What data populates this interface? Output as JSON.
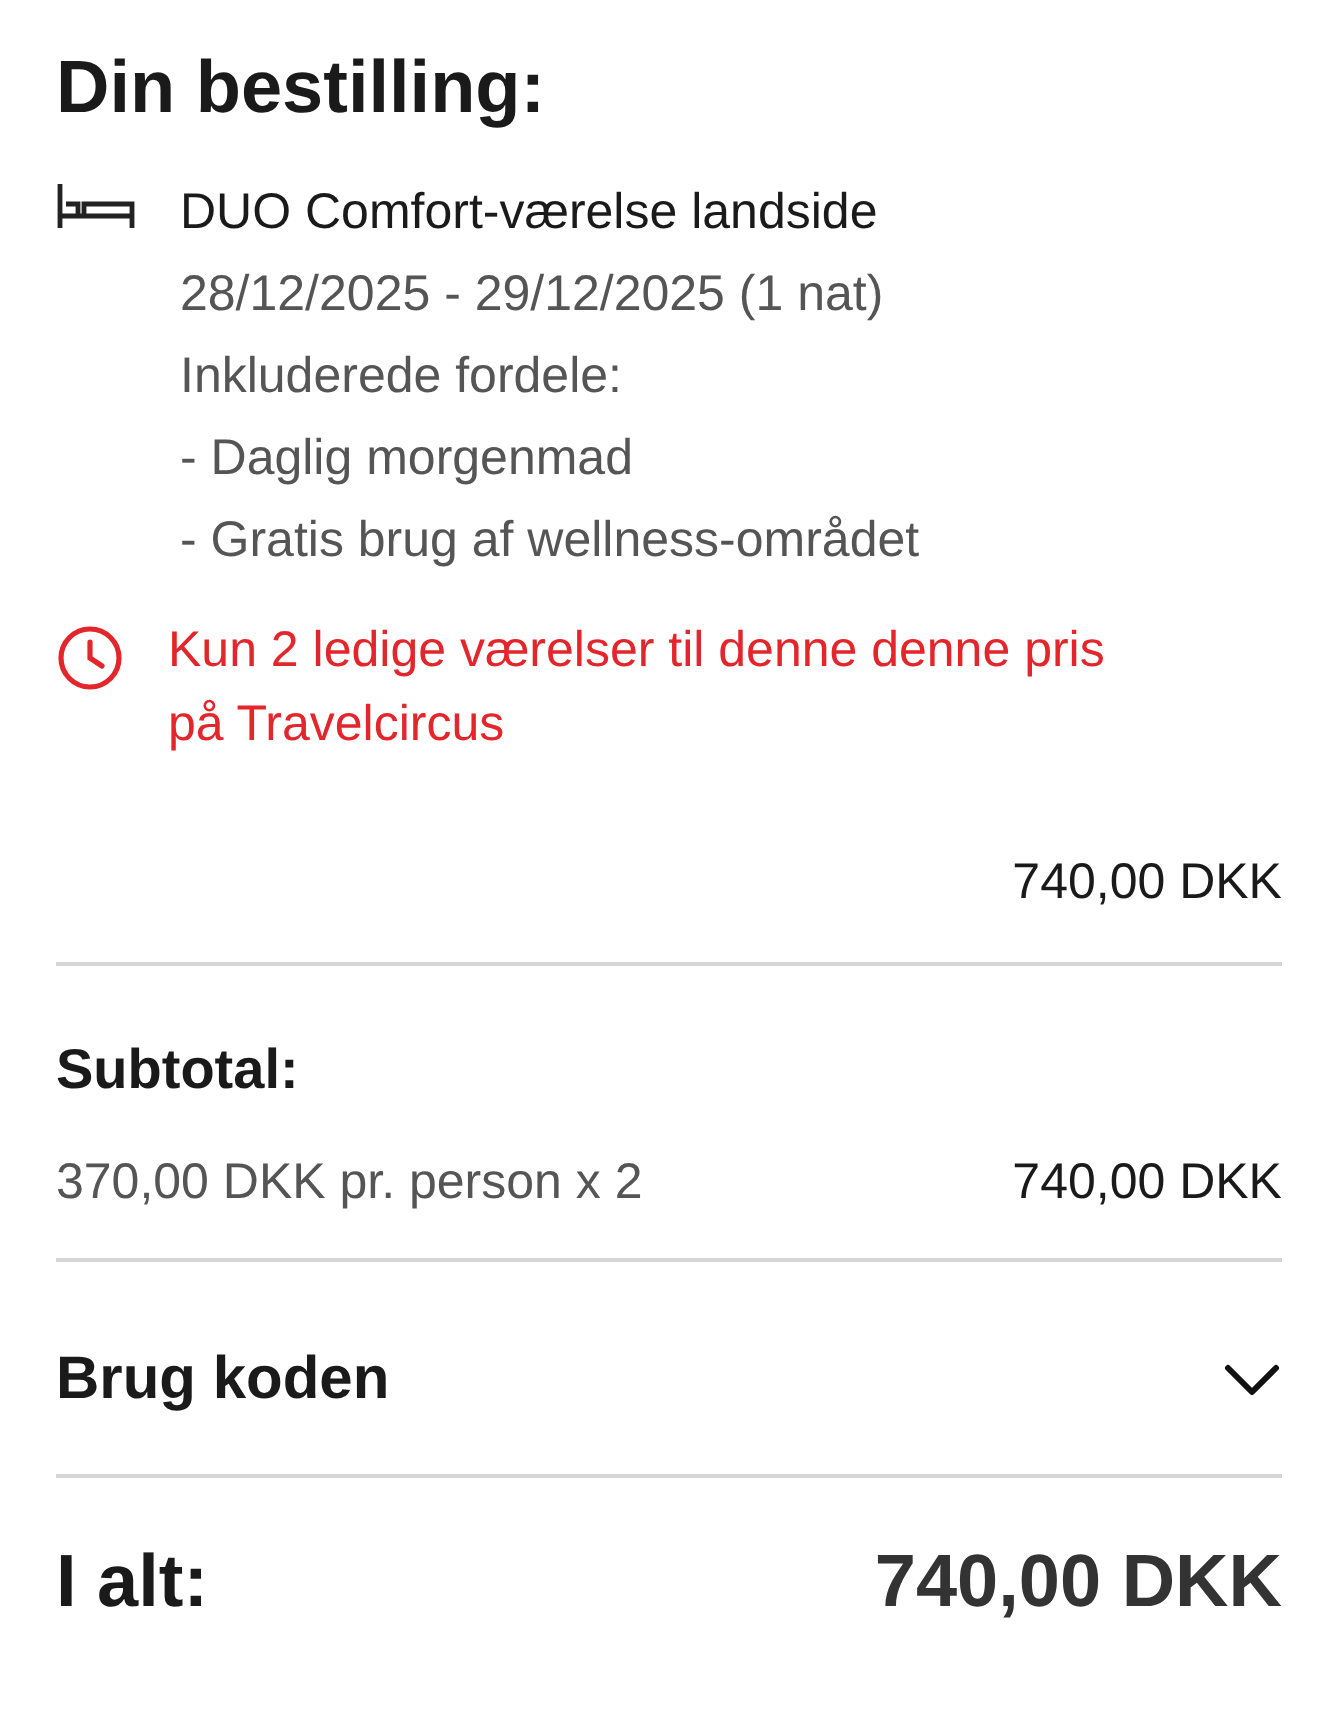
{
  "title": "Din bestilling:",
  "room": {
    "name": "DUO Comfort-værelse landside",
    "dates": "28/12/2025 - 29/12/2025 (1 nat)",
    "benefits_heading": "Inkluderede fordele:",
    "benefits": [
      "- Daglig morgenmad",
      "- Gratis brug af wellness-området"
    ]
  },
  "warning": "Kun 2 ledige værelser til denne denne pris på Travelcircus",
  "room_price": "740,00 DKK",
  "subtotal": {
    "label": "Subtotal:",
    "detail": "370,00 DKK pr. person x 2",
    "amount": "740,00 DKK"
  },
  "code": {
    "label": "Brug koden",
    "expanded": false
  },
  "total": {
    "label": "I alt:",
    "amount": "740,00 DKK"
  }
}
